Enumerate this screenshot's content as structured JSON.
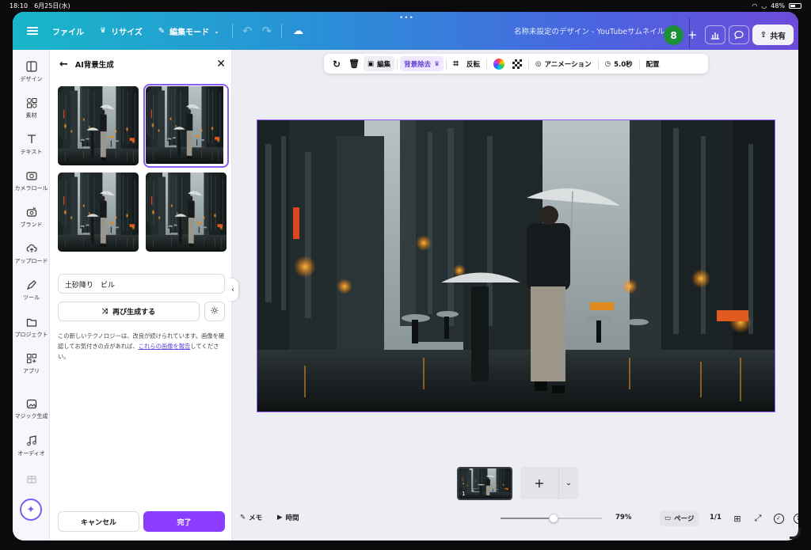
{
  "status_bar": {
    "time": "18:10",
    "date": "6月25日(水)",
    "battery": "48%"
  },
  "topbar": {
    "file_label": "ファイル",
    "resize_label": "リサイズ",
    "edit_mode_label": "編集モード",
    "doc_title": "名称未設定のデザイン - YouTubeサムネイル",
    "avatar_initial": "8",
    "share_label": "共有"
  },
  "rail": {
    "items": [
      "デザイン",
      "素材",
      "テキスト",
      "カメラロール",
      "ブランド",
      "アップロード",
      "ツール",
      "プロジェクト",
      "アプリ",
      "マジック生成",
      "オーディオ"
    ]
  },
  "panel": {
    "title": "AI背景生成",
    "prompt_value": "土砂降り　ビル",
    "regenerate_label": "再び生成する",
    "note_before": "この新しいテクノロジーは、改良が続けられています。画像を確認してお気付きの点があれば、",
    "note_link": "これらの画像を報告",
    "note_after": "してください。",
    "cancel_label": "キャンセル",
    "done_label": "完了",
    "selected_thumb": 2
  },
  "toolbar": {
    "edit_label": "編集",
    "bg_remove_label": "背景除去",
    "flip_label": "反転",
    "animation_label": "アニメーション",
    "duration_label": "5.0秒",
    "position_label": "配置"
  },
  "pages": {
    "thumb_number": "1"
  },
  "bottombar": {
    "notes_label": "メモ",
    "time_label": "時間",
    "zoom": "79%",
    "zoom_fraction": 0.52,
    "pages_label": "ページ",
    "page_count": "1/1"
  },
  "colors": {
    "accent": "#8b3dff",
    "selection": "#8b5cf6",
    "gradient_start": "#19b6c9",
    "gradient_end": "#6d4bd9"
  }
}
